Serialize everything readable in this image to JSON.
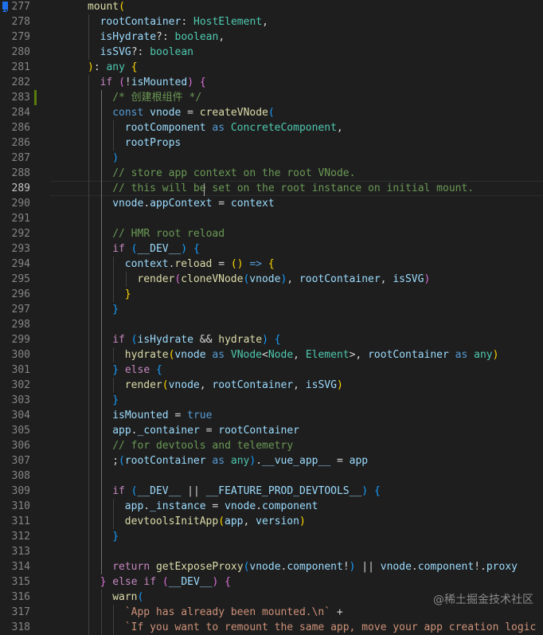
{
  "editor": {
    "language": "typescript",
    "watermark": "@稀土掘金技术社区",
    "active_line": 289,
    "modified_line": 283,
    "bookmarked_line": 277,
    "lines": [
      {
        "n": 277,
        "i": 0,
        "t": [
          [
            "fn",
            "mount"
          ],
          [
            "p1",
            "("
          ]
        ]
      },
      {
        "n": 278,
        "i": 1,
        "t": [
          [
            "var",
            "rootContainer"
          ],
          [
            "plain",
            ": "
          ],
          [
            "type",
            "HostElement"
          ],
          [
            "plain",
            ","
          ]
        ]
      },
      {
        "n": 279,
        "i": 1,
        "t": [
          [
            "var",
            "isHydrate"
          ],
          [
            "plain",
            "?: "
          ],
          [
            "type",
            "boolean"
          ],
          [
            "plain",
            ","
          ]
        ]
      },
      {
        "n": 280,
        "i": 1,
        "t": [
          [
            "var",
            "isSVG"
          ],
          [
            "plain",
            "?: "
          ],
          [
            "type",
            "boolean"
          ]
        ]
      },
      {
        "n": 281,
        "i": 0,
        "t": [
          [
            "p1",
            ")"
          ],
          [
            "plain",
            ": "
          ],
          [
            "type",
            "any"
          ],
          [
            "plain",
            " "
          ],
          [
            "p1",
            "{"
          ]
        ]
      },
      {
        "n": 282,
        "i": 1,
        "t": [
          [
            "ctl",
            "if"
          ],
          [
            "plain",
            " "
          ],
          [
            "p2",
            "("
          ],
          [
            "plain",
            "!"
          ],
          [
            "var",
            "isMounted"
          ],
          [
            "p2",
            ")"
          ],
          [
            "plain",
            " "
          ],
          [
            "p2",
            "{"
          ]
        ]
      },
      {
        "n": 283,
        "i": 2,
        "t": [
          [
            "cm",
            "/* 创建根组件 */"
          ]
        ]
      },
      {
        "n": 284,
        "i": 2,
        "t": [
          [
            "kw",
            "const"
          ],
          [
            "plain",
            " "
          ],
          [
            "var",
            "vnode"
          ],
          [
            "plain",
            " = "
          ],
          [
            "fn",
            "createVNode"
          ],
          [
            "p3",
            "("
          ]
        ]
      },
      {
        "n": 286,
        "i": 3,
        "t": [
          [
            "var",
            "rootComponent"
          ],
          [
            "plain",
            " "
          ],
          [
            "kw",
            "as"
          ],
          [
            "plain",
            " "
          ],
          [
            "type",
            "ConcreteComponent"
          ],
          [
            "plain",
            ","
          ]
        ]
      },
      {
        "n": 286,
        "i": 3,
        "t": [
          [
            "var",
            "rootProps"
          ]
        ]
      },
      {
        "n": 287,
        "i": 2,
        "t": [
          [
            "p3",
            ")"
          ]
        ]
      },
      {
        "n": 288,
        "i": 2,
        "t": [
          [
            "cm",
            "// store app context on the root VNode."
          ]
        ]
      },
      {
        "n": 289,
        "i": 2,
        "t": [
          [
            "cm",
            "// this will be set on the root instance on initial mount."
          ]
        ]
      },
      {
        "n": 290,
        "i": 2,
        "t": [
          [
            "var",
            "vnode"
          ],
          [
            "plain",
            "."
          ],
          [
            "var",
            "appContext"
          ],
          [
            "plain",
            " = "
          ],
          [
            "var",
            "context"
          ]
        ]
      },
      {
        "n": 291,
        "i": 0,
        "t": []
      },
      {
        "n": 292,
        "i": 2,
        "t": [
          [
            "cm",
            "// HMR root reload"
          ]
        ]
      },
      {
        "n": 293,
        "i": 2,
        "t": [
          [
            "ctl",
            "if"
          ],
          [
            "plain",
            " "
          ],
          [
            "p3",
            "("
          ],
          [
            "var",
            "__DEV__"
          ],
          [
            "p3",
            ")"
          ],
          [
            "plain",
            " "
          ],
          [
            "p3",
            "{"
          ]
        ]
      },
      {
        "n": 294,
        "i": 3,
        "t": [
          [
            "var",
            "context"
          ],
          [
            "plain",
            "."
          ],
          [
            "fn",
            "reload"
          ],
          [
            "plain",
            " = "
          ],
          [
            "p1",
            "()"
          ],
          [
            "plain",
            " "
          ],
          [
            "kw",
            "=>"
          ],
          [
            "plain",
            " "
          ],
          [
            "p1",
            "{"
          ]
        ]
      },
      {
        "n": 295,
        "i": 4,
        "t": [
          [
            "fn",
            "render"
          ],
          [
            "p2",
            "("
          ],
          [
            "fn",
            "cloneVNode"
          ],
          [
            "p3",
            "("
          ],
          [
            "var",
            "vnode"
          ],
          [
            "p3",
            ")"
          ],
          [
            "plain",
            ", "
          ],
          [
            "var",
            "rootContainer"
          ],
          [
            "plain",
            ", "
          ],
          [
            "var",
            "isSVG"
          ],
          [
            "p2",
            ")"
          ]
        ]
      },
      {
        "n": 296,
        "i": 3,
        "t": [
          [
            "p1",
            "}"
          ]
        ]
      },
      {
        "n": 297,
        "i": 2,
        "t": [
          [
            "p3",
            "}"
          ]
        ]
      },
      {
        "n": 298,
        "i": 0,
        "t": []
      },
      {
        "n": 299,
        "i": 2,
        "t": [
          [
            "ctl",
            "if"
          ],
          [
            "plain",
            " "
          ],
          [
            "p3",
            "("
          ],
          [
            "var",
            "isHydrate"
          ],
          [
            "plain",
            " && "
          ],
          [
            "fn",
            "hydrate"
          ],
          [
            "p3",
            ")"
          ],
          [
            "plain",
            " "
          ],
          [
            "p3",
            "{"
          ]
        ]
      },
      {
        "n": 300,
        "i": 3,
        "t": [
          [
            "fn",
            "hydrate"
          ],
          [
            "p1",
            "("
          ],
          [
            "var",
            "vnode"
          ],
          [
            "plain",
            " "
          ],
          [
            "kw",
            "as"
          ],
          [
            "plain",
            " "
          ],
          [
            "type",
            "VNode"
          ],
          [
            "plain",
            "<"
          ],
          [
            "type",
            "Node"
          ],
          [
            "plain",
            ", "
          ],
          [
            "type",
            "Element"
          ],
          [
            "plain",
            ">, "
          ],
          [
            "var",
            "rootContainer"
          ],
          [
            "plain",
            " "
          ],
          [
            "kw",
            "as"
          ],
          [
            "plain",
            " "
          ],
          [
            "type",
            "any"
          ],
          [
            "p1",
            ")"
          ]
        ]
      },
      {
        "n": 301,
        "i": 2,
        "t": [
          [
            "p3",
            "}"
          ],
          [
            "plain",
            " "
          ],
          [
            "ctl",
            "else"
          ],
          [
            "plain",
            " "
          ],
          [
            "p3",
            "{"
          ]
        ]
      },
      {
        "n": 302,
        "i": 3,
        "t": [
          [
            "fn",
            "render"
          ],
          [
            "p1",
            "("
          ],
          [
            "var",
            "vnode"
          ],
          [
            "plain",
            ", "
          ],
          [
            "var",
            "rootContainer"
          ],
          [
            "plain",
            ", "
          ],
          [
            "var",
            "isSVG"
          ],
          [
            "p1",
            ")"
          ]
        ]
      },
      {
        "n": 303,
        "i": 2,
        "t": [
          [
            "p3",
            "}"
          ]
        ]
      },
      {
        "n": 304,
        "i": 2,
        "t": [
          [
            "var",
            "isMounted"
          ],
          [
            "plain",
            " = "
          ],
          [
            "kw",
            "true"
          ]
        ]
      },
      {
        "n": 305,
        "i": 2,
        "t": [
          [
            "var",
            "app"
          ],
          [
            "plain",
            "."
          ],
          [
            "var",
            "_container"
          ],
          [
            "plain",
            " = "
          ],
          [
            "var",
            "rootContainer"
          ]
        ]
      },
      {
        "n": 306,
        "i": 2,
        "t": [
          [
            "cm",
            "// for devtools and telemetry"
          ]
        ]
      },
      {
        "n": 307,
        "i": 2,
        "t": [
          [
            "plain",
            ";"
          ],
          [
            "p3",
            "("
          ],
          [
            "var",
            "rootContainer"
          ],
          [
            "plain",
            " "
          ],
          [
            "kw",
            "as"
          ],
          [
            "plain",
            " "
          ],
          [
            "type",
            "any"
          ],
          [
            "p3",
            ")"
          ],
          [
            "plain",
            "."
          ],
          [
            "var",
            "__vue_app__"
          ],
          [
            "plain",
            " = "
          ],
          [
            "var",
            "app"
          ]
        ]
      },
      {
        "n": 308,
        "i": 0,
        "t": []
      },
      {
        "n": 309,
        "i": 2,
        "t": [
          [
            "ctl",
            "if"
          ],
          [
            "plain",
            " "
          ],
          [
            "p3",
            "("
          ],
          [
            "var",
            "__DEV__"
          ],
          [
            "plain",
            " || "
          ],
          [
            "var",
            "__FEATURE_PROD_DEVTOOLS__"
          ],
          [
            "p3",
            ")"
          ],
          [
            "plain",
            " "
          ],
          [
            "p3",
            "{"
          ]
        ]
      },
      {
        "n": 310,
        "i": 3,
        "t": [
          [
            "var",
            "app"
          ],
          [
            "plain",
            "."
          ],
          [
            "var",
            "_instance"
          ],
          [
            "plain",
            " = "
          ],
          [
            "var",
            "vnode"
          ],
          [
            "plain",
            "."
          ],
          [
            "var",
            "component"
          ]
        ]
      },
      {
        "n": 311,
        "i": 3,
        "t": [
          [
            "fn",
            "devtoolsInitApp"
          ],
          [
            "p1",
            "("
          ],
          [
            "var",
            "app"
          ],
          [
            "plain",
            ", "
          ],
          [
            "var",
            "version"
          ],
          [
            "p1",
            ")"
          ]
        ]
      },
      {
        "n": 312,
        "i": 2,
        "t": [
          [
            "p3",
            "}"
          ]
        ]
      },
      {
        "n": 313,
        "i": 0,
        "t": []
      },
      {
        "n": 314,
        "i": 2,
        "t": [
          [
            "ctl",
            "return"
          ],
          [
            "plain",
            " "
          ],
          [
            "fn",
            "getExposeProxy"
          ],
          [
            "p3",
            "("
          ],
          [
            "var",
            "vnode"
          ],
          [
            "plain",
            "."
          ],
          [
            "var",
            "component"
          ],
          [
            "plain",
            "!"
          ],
          [
            "p3",
            ")"
          ],
          [
            "plain",
            " || "
          ],
          [
            "var",
            "vnode"
          ],
          [
            "plain",
            "."
          ],
          [
            "var",
            "component"
          ],
          [
            "plain",
            "!."
          ],
          [
            "var",
            "proxy"
          ]
        ]
      },
      {
        "n": 315,
        "i": 1,
        "t": [
          [
            "p2",
            "}"
          ],
          [
            "plain",
            " "
          ],
          [
            "ctl",
            "else"
          ],
          [
            "plain",
            " "
          ],
          [
            "ctl",
            "if"
          ],
          [
            "plain",
            " "
          ],
          [
            "p2",
            "("
          ],
          [
            "var",
            "__DEV__"
          ],
          [
            "p2",
            ")"
          ],
          [
            "plain",
            " "
          ],
          [
            "p2",
            "{"
          ]
        ]
      },
      {
        "n": 316,
        "i": 2,
        "t": [
          [
            "fn",
            "warn"
          ],
          [
            "p3",
            "("
          ]
        ]
      },
      {
        "n": 317,
        "i": 3,
        "t": [
          [
            "str",
            "`App has already been mounted.\\n`"
          ],
          [
            "plain",
            " +"
          ]
        ]
      },
      {
        "n": 318,
        "i": 3,
        "t": [
          [
            "str",
            "`If you want to remount the same app, move your app creation logic `"
          ]
        ]
      }
    ]
  }
}
